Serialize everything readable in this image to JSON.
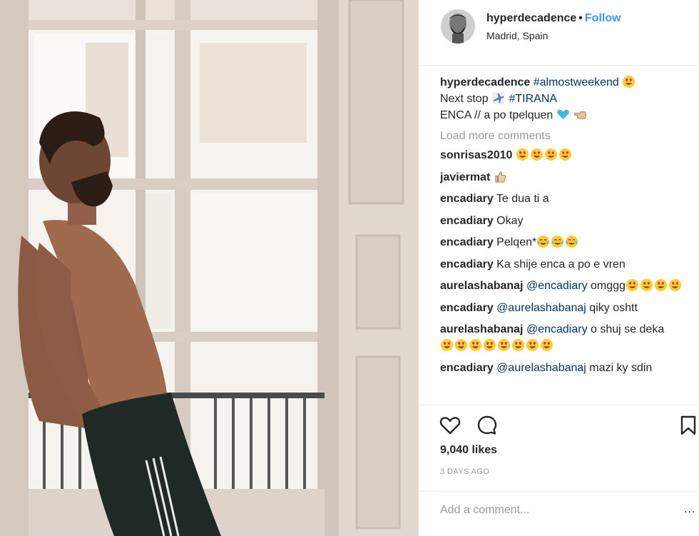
{
  "post": {
    "username": "hyperdecadence",
    "separator": "•",
    "follow_label": "Follow",
    "location": "Madrid, Spain",
    "photo_description_icon": "photo"
  },
  "caption": {
    "username": "hyperdecadence",
    "line1_tag": "#almostweekend",
    "line2_text": "Next stop",
    "line2_tag": "#TIRANA",
    "line3_text": "ENCA // a po tpelquen"
  },
  "load_more": "Load more comments",
  "comments": [
    {
      "user": "sonrisas2010",
      "text": "",
      "emoji": [
        "heart-eyes",
        "heart-eyes",
        "heart-eyes",
        "heart-eyes"
      ]
    },
    {
      "user": "javiermat",
      "text": "",
      "emoji": [
        "thumbs-up"
      ]
    },
    {
      "user": "encadiary",
      "text": "Te dua ti a",
      "emoji": []
    },
    {
      "user": "encadiary",
      "text": "Okay",
      "emoji": []
    },
    {
      "user": "encadiary",
      "text": "Pelqen*",
      "emoji": [
        "tears-joy",
        "tears-joy",
        "tears-joy"
      ]
    },
    {
      "user": "encadiary",
      "text": "Ka shije enca a po e vren",
      "emoji": []
    },
    {
      "user": "aurelashabanaj",
      "mention": "@encadiary",
      "text": "omggg",
      "emoji": [
        "heart-eyes",
        "heart-eyes",
        "heart-eyes",
        "heart-eyes"
      ]
    },
    {
      "user": "encadiary",
      "mention": "@aurelashabanaj",
      "text": "qiky oshtt",
      "emoji": []
    },
    {
      "user": "aurelashabanaj",
      "mention": "@encadiary",
      "text": "o shuj se deka",
      "emoji": [
        "heart-eyes",
        "heart-eyes",
        "heart-eyes",
        "heart-eyes",
        "heart-eyes",
        "heart-eyes",
        "heart-eyes",
        "heart-eyes"
      ]
    },
    {
      "user": "encadiary",
      "mention": "@aurelashabanaj",
      "text": "mazi ky sdin",
      "emoji": []
    }
  ],
  "likes": "9,040 likes",
  "timestamp": "3 DAYS AGO",
  "add_comment_placeholder": "Add a comment...",
  "more_label": "...",
  "colors": {
    "accent": "#3897f0",
    "hashtag": "#003569",
    "muted": "#999999",
    "text": "#262626"
  },
  "icons": {
    "like": "heart-outline-icon",
    "comment": "speech-bubble-icon",
    "save": "bookmark-icon"
  }
}
